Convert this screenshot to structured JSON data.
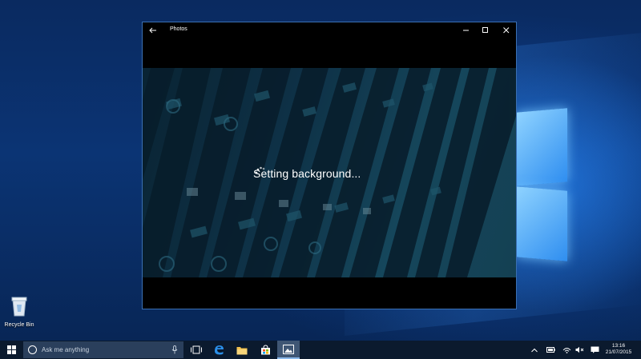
{
  "desktop": {
    "recycle_bin_label": "Recycle Bin"
  },
  "window": {
    "title": "Photos",
    "status_text": "Setting background..."
  },
  "taskbar": {
    "search_placeholder": "Ask me anything",
    "clock_time": "13:16",
    "clock_date": "21/07/2015"
  },
  "colors": {
    "accent": "#3f5674",
    "taskbar_bg": "#0b1a2e",
    "window_border": "#3a6fb3"
  },
  "icons": {
    "back": "back-arrow-icon",
    "minimize": "minimize-icon",
    "maximize": "maximize-icon",
    "close": "close-icon",
    "start": "windows-logo-icon",
    "cortana": "cortana-circle-icon",
    "mic": "microphone-icon",
    "task_view": "task-view-icon",
    "edge": "edge-icon",
    "explorer": "folder-icon",
    "store": "store-icon",
    "photos": "photos-icon",
    "spinner": "loading-spinner-icon"
  }
}
